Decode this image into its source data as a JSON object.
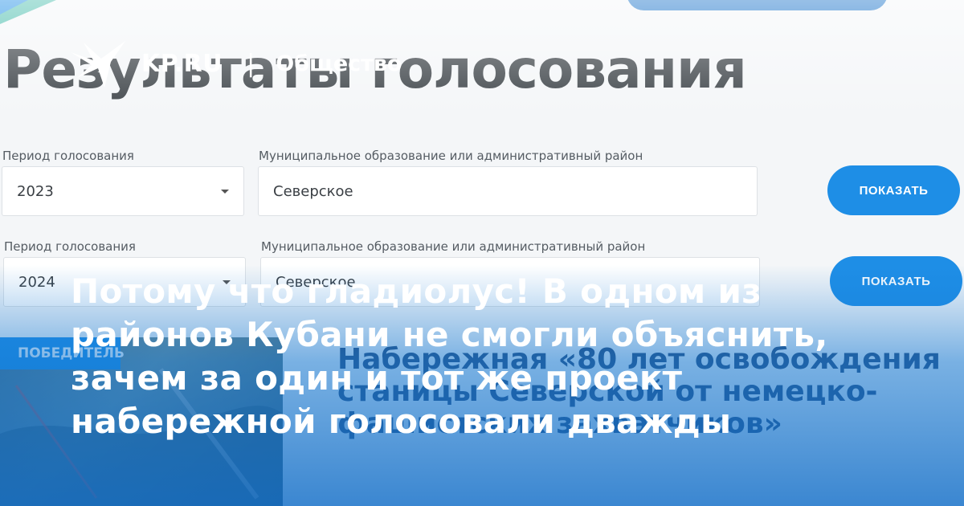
{
  "background": {
    "title": "Результаты голосования",
    "rows": [
      {
        "period_label": "Период голосования",
        "period_value": "2023",
        "district_label": "Муниципальное образование или административный район",
        "district_value": "Северское",
        "button_label": "ПОКАЗАТЬ"
      },
      {
        "period_label": "Период голосования",
        "period_value": "2024",
        "district_label": "Муниципальное образование или административный район",
        "district_value": "Северское",
        "button_label": "ПОКАЗАТЬ"
      }
    ],
    "winner_badge": "ПОБЕДИТЕЛЬ",
    "project_title": "Набережная «80 лет освобождения станицы Северской от немецко-фашистских захватчиков»"
  },
  "brand": {
    "logo_text": "KP.RU",
    "separator": "|",
    "section": "Общество"
  },
  "headline": "Потому что гладиолус! В одном из районов Кубани не смогли объяснить, зачем за один и тот же проект набережной голосовали дважды",
  "colors": {
    "accent": "#1e8ee6",
    "overlay_blue": "#1478d2",
    "title_gray": "#3d4348",
    "project_blue": "#2a4a78"
  }
}
